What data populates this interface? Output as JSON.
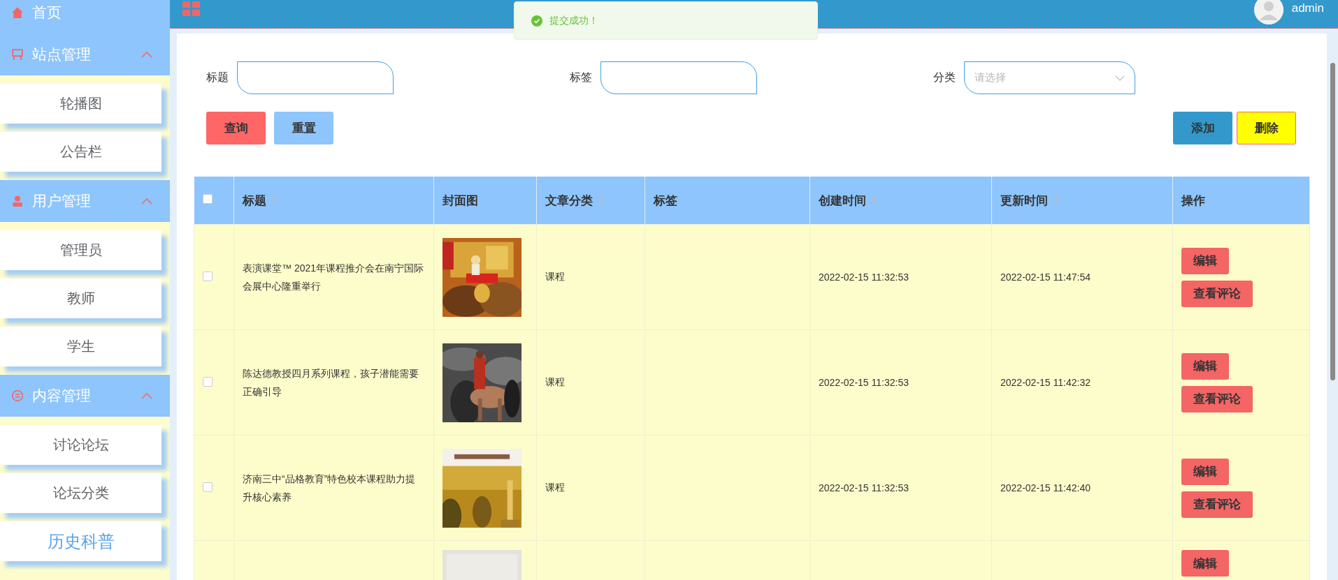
{
  "sidebar": {
    "items": [
      {
        "kind": "link",
        "label": "首页"
      },
      {
        "kind": "group",
        "label": "站点管理",
        "expanded": true,
        "children": [
          {
            "label": "轮播图",
            "selected": false
          },
          {
            "label": "公告栏",
            "selected": false
          }
        ]
      },
      {
        "kind": "group",
        "label": "用户管理",
        "expanded": true,
        "children": [
          {
            "label": "管理员",
            "selected": false
          },
          {
            "label": "教师",
            "selected": false
          },
          {
            "label": "学生",
            "selected": false
          }
        ]
      },
      {
        "kind": "group",
        "label": "内容管理",
        "expanded": true,
        "children": [
          {
            "label": "讨论论坛",
            "selected": false
          },
          {
            "label": "论坛分类",
            "selected": false
          },
          {
            "label": "历史科普",
            "selected": true
          }
        ]
      }
    ]
  },
  "header": {
    "user": "admin"
  },
  "toast": {
    "message": "提交成功！"
  },
  "search": {
    "fields": [
      {
        "kind": "input",
        "label": "标题"
      },
      {
        "kind": "input",
        "label": "标签"
      },
      {
        "kind": "select",
        "label": "分类",
        "placeholder": "请选择"
      }
    ],
    "left_buttons": [
      {
        "kind": "search",
        "label": "查询"
      },
      {
        "kind": "reset",
        "label": "重置"
      }
    ],
    "right_buttons": [
      {
        "kind": "add",
        "label": "添加"
      },
      {
        "kind": "delete",
        "label": "删除"
      }
    ]
  },
  "table": {
    "header_checked": false,
    "columns": [
      {
        "label": "标题",
        "sortable": true
      },
      {
        "label": "封面图",
        "sortable": false
      },
      {
        "label": "文章分类",
        "sortable": true
      },
      {
        "label": "标签",
        "sortable": false
      },
      {
        "label": "创建时间",
        "sortable": true
      },
      {
        "label": "更新时间",
        "sortable": true
      },
      {
        "label": "操作",
        "sortable": false
      }
    ],
    "rows": [
      {
        "checked": false,
        "title": "表演课堂™ 2021年课程推介会在南宁国际会展中心隆重举行",
        "cover": {
          "kind": "picture"
        },
        "category": "课程",
        "created": "2022-02-15 11:32:53",
        "updated": "2022-02-15 11:47:54",
        "actions": [
          "编辑",
          "查看评论"
        ]
      },
      {
        "checked": false,
        "title": "陈达德教授四月系列课程，孩子潜能需要正确引导",
        "cover": {
          "kind": "picture"
        },
        "category": "课程",
        "created": "2022-02-15 11:32:53",
        "updated": "2022-02-15 11:42:32",
        "actions": [
          "编辑",
          "查看评论"
        ]
      },
      {
        "checked": false,
        "title": "济南三中“品格教育”特色校本课程助力提升核心素养",
        "cover": {
          "kind": "picture"
        },
        "category": "课程",
        "created": "2022-02-15 11:32:53",
        "updated": "2022-02-15 11:42:40",
        "actions": [
          "编辑",
          "查看评论"
        ]
      },
      {
        "cover": {
          "kind": "picture"
        },
        "actions": [
          "编辑"
        ]
      }
    ]
  }
}
